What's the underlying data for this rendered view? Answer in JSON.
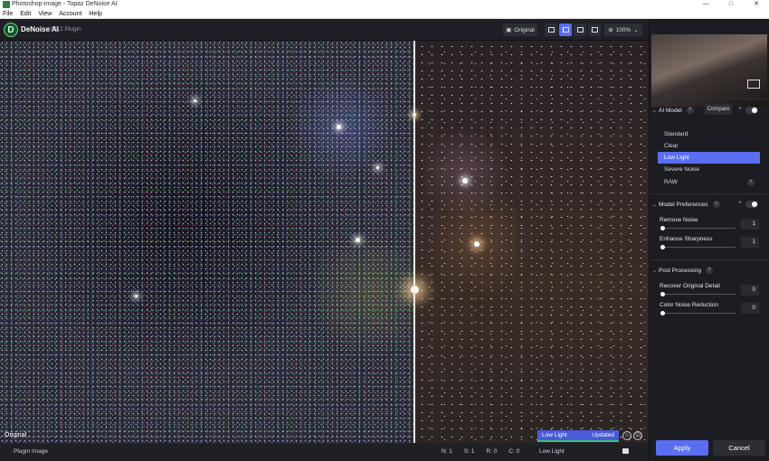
{
  "window": {
    "title": "Photoshop-image - Topaz DeNoise AI",
    "controls": [
      "—",
      "□",
      "✕"
    ]
  },
  "menu": [
    "File",
    "Edit",
    "View",
    "Account",
    "Help"
  ],
  "toolbar": {
    "brand": "DeNoise AI",
    "version": "v3.7.2 Plugin",
    "original_label": "Original",
    "zoom": "100%"
  },
  "canvas": {
    "left_label": "Original",
    "model_tag": "Low Light",
    "model_status": "Updated"
  },
  "statusbar": {
    "left": "Plugin Image",
    "stats": [
      "N: 1",
      "S: 1",
      "R: 0",
      "C: 0"
    ],
    "model": "Low Light"
  },
  "panel": {
    "ai_model": {
      "title": "AI Model",
      "compare_label": "Compare",
      "items": [
        "Standard",
        "Clear",
        "Low Light",
        "Severe Noise",
        "RAW"
      ],
      "selected": "Low Light"
    },
    "model_prefs": {
      "title": "Model Preferences",
      "sliders": [
        {
          "label": "Remove Noise",
          "value": "1"
        },
        {
          "label": "Enhance Sharpness",
          "value": "1"
        }
      ]
    },
    "post": {
      "title": "Post Processing",
      "sliders": [
        {
          "label": "Recover Original Detail",
          "value": "0"
        },
        {
          "label": "Color Noise Reduction",
          "value": "0"
        }
      ]
    },
    "apply_label": "Apply",
    "cancel_label": "Cancel"
  },
  "colors": {
    "accent": "#5a6ef2",
    "updated_bar": "#3ac07a",
    "logo": "#0c5a2e"
  }
}
